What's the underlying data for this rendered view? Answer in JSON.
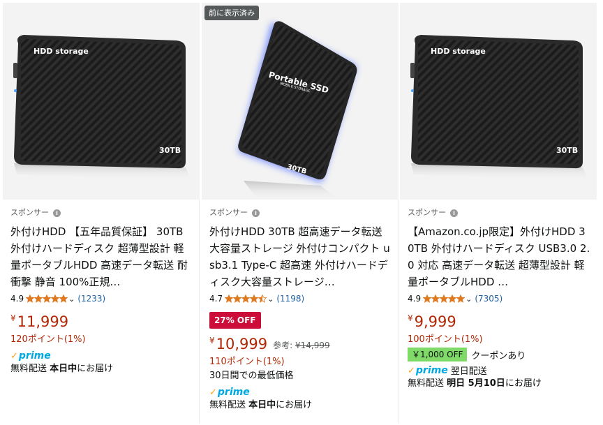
{
  "cards": [
    {
      "image_label_top": "HDD storage",
      "image_label_capacity": "30TB",
      "sponsored": "スポンサー",
      "title": "外付けHDD 【五年品質保証】 30TB 外付けハードディスク 超薄型設計 軽量ポータブルHDD 高速データ転送 耐衝撃 静音 100%正規…",
      "rating": "4.9",
      "stars": 5,
      "reviews": "(1233)",
      "yen": "¥",
      "price": "11,999",
      "points": "120ポイント(1%)",
      "prime": "prime",
      "delivery_prefix": "無料配送 ",
      "delivery_bold": "本日中",
      "delivery_suffix": "にお届け"
    },
    {
      "viewed_badge": "前に表示済み",
      "image_label_top": "Portable SSD",
      "image_label_sub": "MOBILE STORAGE",
      "image_label_capacity": "30TB",
      "sponsored": "スポンサー",
      "title": "外付けHDD 30TB 超高速データ転送 大容量ストレージ 外付けコンパクト usb3.1 Type-C 超高速 外付けハードディスク大容量ストレージ…",
      "rating": "4.7",
      "stars": 4.5,
      "reviews": "(1198)",
      "deal_badge": "27% OFF",
      "yen": "¥",
      "price": "10,999",
      "ref_label": "参考: ",
      "ref_price": "¥14,999",
      "points": "110ポイント(1%)",
      "lowest": "30日間での最低価格",
      "prime": "prime",
      "delivery_prefix": "無料配送 ",
      "delivery_bold": "本日中",
      "delivery_suffix": "にお届け"
    },
    {
      "image_label_top": "HDD storage",
      "image_label_capacity": "30TB",
      "sponsored": "スポンサー",
      "title": "【Amazon.co.jp限定】外付けHDD 30TB 外付けハードディスク USB3.0 2.0 対応 高速データ転送 超薄型設計 軽量ポータブルHDD …",
      "rating": "4.9",
      "stars": 5,
      "reviews": "(7305)",
      "yen": "¥",
      "price": "9,999",
      "points": "100ポイント(1%)",
      "coupon": "￥1,000 OFF",
      "coupon_text": "クーポンあり",
      "prime": "prime",
      "prime_extra": "翌日配送",
      "delivery_prefix": "無料配送 ",
      "delivery_bold": "明日 5月10日",
      "delivery_suffix": "にお届け"
    }
  ],
  "colors": {
    "price": "#b12704",
    "star": "#de7921",
    "link": "#2162a1",
    "deal": "#cc0c39",
    "coupon": "#7fda69",
    "prime_blue": "#00a8e1",
    "prime_check": "#ffa41c"
  }
}
